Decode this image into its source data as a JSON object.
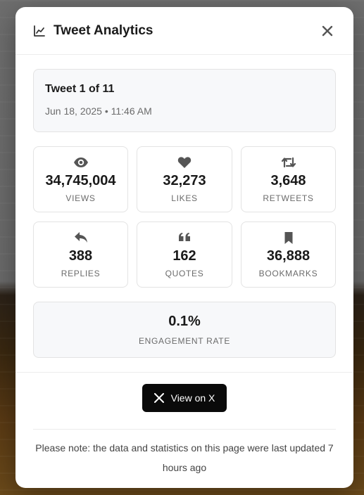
{
  "modal": {
    "title": "Tweet Analytics",
    "icons": {
      "title": "chart-line-icon",
      "close": "close-icon"
    }
  },
  "tweet": {
    "title": "Tweet 1 of 11",
    "date": "Jun 18, 2025 • 11:46 AM"
  },
  "stats": [
    {
      "icon": "eye-icon",
      "value": "34,745,004",
      "label": "VIEWS"
    },
    {
      "icon": "heart-icon",
      "value": "32,273",
      "label": "LIKES"
    },
    {
      "icon": "retweet-icon",
      "value": "3,648",
      "label": "RETWEETS"
    },
    {
      "icon": "reply-icon",
      "value": "388",
      "label": "REPLIES"
    },
    {
      "icon": "quote-icon",
      "value": "162",
      "label": "QUOTES"
    },
    {
      "icon": "bookmark-icon",
      "value": "36,888",
      "label": "BOOKMARKS"
    }
  ],
  "engagement": {
    "value": "0.1%",
    "label": "ENGAGEMENT RATE"
  },
  "actions": {
    "view_label": "View on X",
    "view_icon": "x-logo-icon"
  },
  "note": "Please note: the data and statistics on this page were last updated 7 hours ago",
  "colors": {
    "icon": "#555555",
    "button_bg": "#0a0a0a",
    "card_bg": "#f7f8fa",
    "border": "#e3e3e3"
  }
}
